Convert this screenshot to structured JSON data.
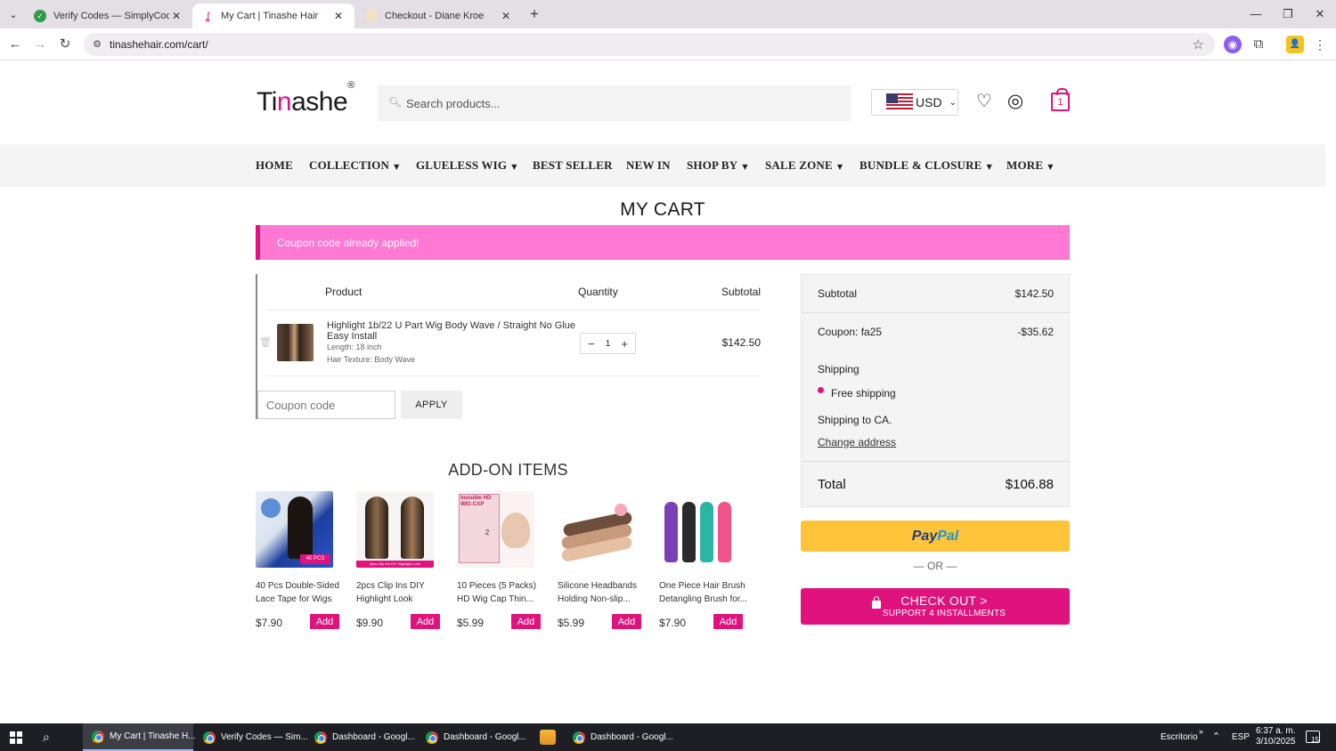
{
  "browser": {
    "tabs": [
      {
        "title": "Verify Codes — SimplyCodes",
        "active": false
      },
      {
        "title": "My Cart | Tinashe Hair",
        "active": true
      },
      {
        "title": "Checkout - Diane Kroe",
        "active": false
      }
    ],
    "url": "tinashehair.com/cart/"
  },
  "header": {
    "logo_part1": "Ti",
    "logo_part2": "n",
    "logo_part3": "ashe",
    "logo_mark": "®",
    "search_placeholder": "Search products...",
    "currency": "USD",
    "cart_count": "1"
  },
  "nav": {
    "items": [
      "HOME",
      "COLLECTION",
      "GLUELESS WIG",
      "BEST SELLER",
      "NEW IN",
      "SHOP BY",
      "SALE ZONE",
      "BUNDLE & CLOSURE",
      "MORE"
    ]
  },
  "page": {
    "title": "MY CART",
    "notice": "Coupon code already applied!"
  },
  "cart": {
    "headers": {
      "product": "Product",
      "quantity": "Quantity",
      "subtotal": "Subtotal"
    },
    "item": {
      "name": "Highlight 1b/22 U Part Wig Body Wave / Straight No Glue Easy Install",
      "length": "Length: 18 inch",
      "texture": "Hair Texture: Body Wave",
      "quantity": "1",
      "subtotal": "$142.50"
    },
    "coupon_placeholder": "Coupon code",
    "apply_label": "APPLY"
  },
  "addons": {
    "title": "ADD-ON ITEMS",
    "add_label": "Add",
    "items": [
      {
        "name_line1": "40 Pcs Double-Sided",
        "name_line2": "Lace Tape for Wigs",
        "price": "$7.90"
      },
      {
        "name_line1": "2pcs Clip Ins DIY",
        "name_line2": "Highlight Look",
        "price": "$9.90"
      },
      {
        "name_line1": "10 Pieces (5 Packs)",
        "name_line2": "HD Wig Cap Thin...",
        "price": "$5.99"
      },
      {
        "name_line1": "Silicone Headbands",
        "name_line2": "Holding Non-slip...",
        "price": "$5.99"
      },
      {
        "name_line1": "One Piece Hair Brush",
        "name_line2": "Detangling Brush for...",
        "price": "$7.90"
      }
    ],
    "image_texts": [
      "40 PCS",
      "2pcs Clip Ins DIY Highlight Look",
      "Invisible HD WIG CAP",
      "2"
    ]
  },
  "summary": {
    "subtotal_label": "Subtotal",
    "subtotal_value": "$142.50",
    "coupon_label": "Coupon: fa25",
    "coupon_value": "-$35.62",
    "shipping_label": "Shipping",
    "shipping_option": "Free shipping",
    "shipping_to": "Shipping to CA.",
    "change_address": "Change address",
    "total_label": "Total",
    "total_value": "$106.88",
    "paypal_part1": "Pay",
    "paypal_part2": "Pal",
    "or_text": "— OR —",
    "checkout_label": "CHECK OUT >",
    "checkout_sub": "SUPPORT 4 INSTALLMENTS"
  },
  "taskbar": {
    "apps": [
      "My Cart | Tinashe H...",
      "Verify Codes — Sim...",
      "Dashboard - Googl...",
      "Dashboard - Googl...",
      "Dashboard - Googl..."
    ],
    "desktop_label": "Escritorio",
    "language": "ESP",
    "time": "6:37 a. m.",
    "date": "3/10/2025",
    "notifications": "15"
  },
  "colors": {
    "brand_pink": "#e0127d",
    "notice_pink": "#ff78d2",
    "paypal_yellow": "#ffc439"
  }
}
